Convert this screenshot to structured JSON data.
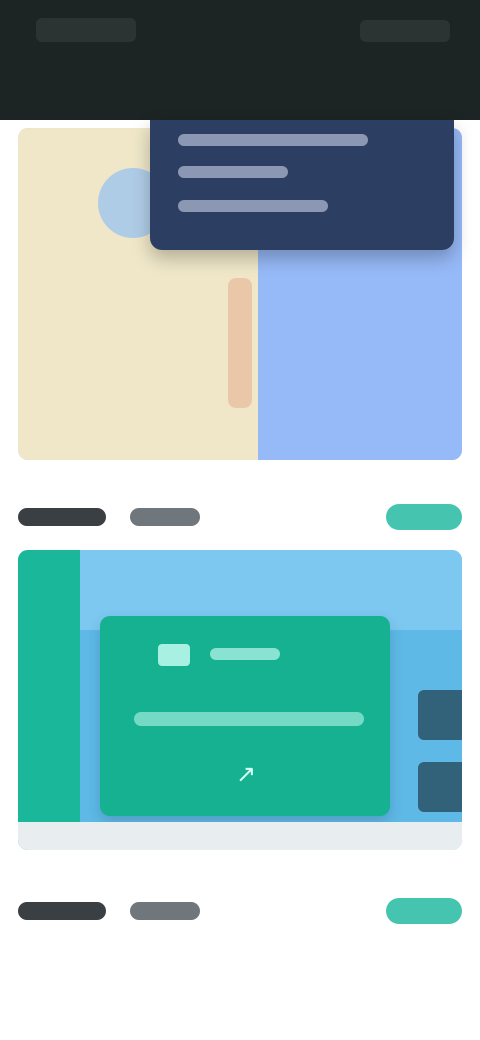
{
  "header": {
    "title": ""
  },
  "feed": {
    "items": [
      {
        "title": "",
        "meta_a": "",
        "meta_b": "",
        "action_label": ""
      },
      {
        "title": "",
        "meta_a": "",
        "meta_b": "",
        "action_label": ""
      }
    ]
  },
  "colors": {
    "header_bg": "#1c2524",
    "accent": "#45c5b0",
    "map_land": "#efe7c8",
    "map_sea": "#96b9f7",
    "sign_green": "#16b190",
    "sky_blue": "#5eb9e7",
    "popup_bg": "#2c3e62"
  }
}
